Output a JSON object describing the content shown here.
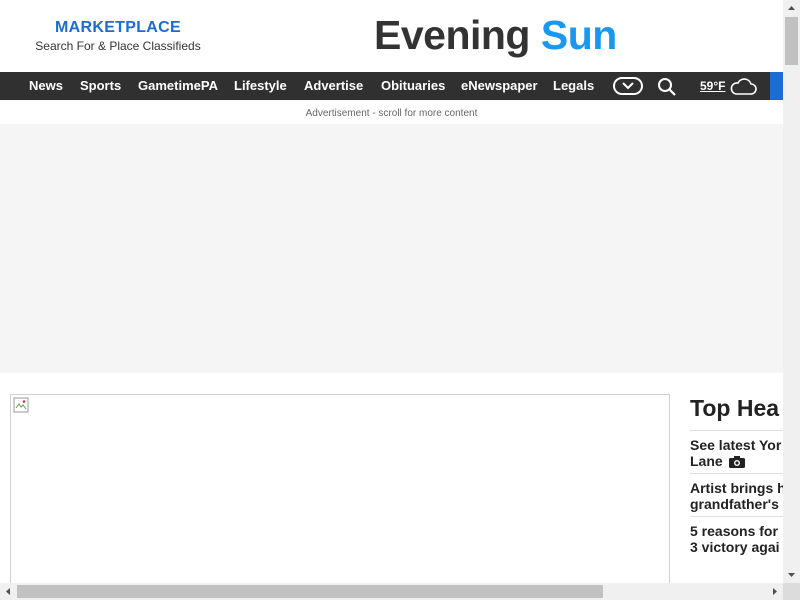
{
  "masthead": {
    "marketplace_title": "MARKETPLACE",
    "marketplace_subtitle": "Search For & Place Classifieds",
    "logo_part1": "Evening",
    "logo_part2": "Sun",
    "logo_color_dark": "#333333",
    "logo_color_accent": "#1a98f0"
  },
  "nav": {
    "items": [
      {
        "label": "News"
      },
      {
        "label": "Sports"
      },
      {
        "label": "GametimePA"
      },
      {
        "label": "Lifestyle"
      },
      {
        "label": "Advertise"
      },
      {
        "label": "Obituaries"
      },
      {
        "label": "eNewspaper"
      },
      {
        "label": "Legals"
      }
    ],
    "more_icon": "chevron-down-icon",
    "search_icon": "search-icon",
    "weather_temp": "59°F",
    "weather_icon": "cloud-icon",
    "bar_color": "#303030",
    "accent_color": "#1a6dd4"
  },
  "ad": {
    "label": "Advertisement - scroll for more content"
  },
  "top_headlines": {
    "title": "Top Hea",
    "items": [
      {
        "line1": "See latest Yor",
        "line2": "Lane",
        "has_camera_icon": true
      },
      {
        "line1": "Artist brings h",
        "line2": "grandfather's",
        "has_camera_icon": false
      },
      {
        "line1": "5 reasons for",
        "line2": "3 victory agai",
        "has_camera_icon": false
      }
    ]
  }
}
